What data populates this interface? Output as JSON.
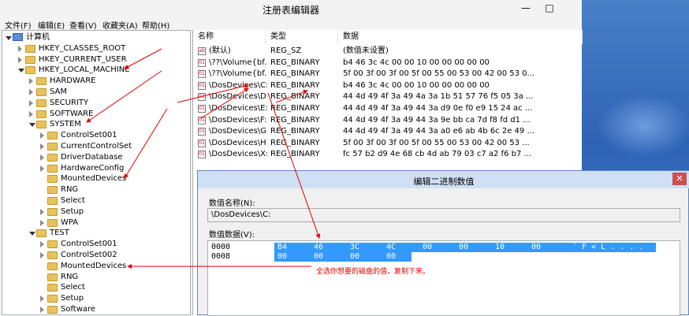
{
  "window": {
    "title": "注册表编辑器",
    "minimize": "—",
    "maximize": "□",
    "close": "✕"
  },
  "menu": [
    "文件(F)",
    "编辑(E)",
    "查看(V)",
    "收藏夹(A)",
    "帮助(H)"
  ],
  "tree": [
    {
      "label": "计算机",
      "level": 0,
      "state": "expanded",
      "icon": "computer-icon"
    },
    {
      "label": "HKEY_CLASSES_ROOT",
      "level": 1,
      "state": "collapsed",
      "icon": "folder-icon"
    },
    {
      "label": "HKEY_CURRENT_USER",
      "level": 1,
      "state": "collapsed",
      "icon": "folder-icon"
    },
    {
      "label": "HKEY_LOCAL_MACHINE",
      "level": 1,
      "state": "expanded",
      "icon": "folder-icon"
    },
    {
      "label": "HARDWARE",
      "level": 2,
      "state": "collapsed",
      "icon": "folder-icon"
    },
    {
      "label": "SAM",
      "level": 2,
      "state": "collapsed",
      "icon": "folder-icon"
    },
    {
      "label": "SECURITY",
      "level": 2,
      "state": "collapsed",
      "icon": "folder-icon"
    },
    {
      "label": "SOFTWARE",
      "level": 2,
      "state": "collapsed",
      "icon": "folder-icon"
    },
    {
      "label": "SYSTEM",
      "level": 2,
      "state": "expanded",
      "icon": "folder-icon"
    },
    {
      "label": "ControlSet001",
      "level": 3,
      "state": "collapsed",
      "icon": "folder-icon"
    },
    {
      "label": "CurrentControlSet",
      "level": 3,
      "state": "collapsed",
      "icon": "folder-icon"
    },
    {
      "label": "DriverDatabase",
      "level": 3,
      "state": "collapsed",
      "icon": "folder-icon"
    },
    {
      "label": "HardwareConfig",
      "level": 3,
      "state": "collapsed",
      "icon": "folder-icon"
    },
    {
      "label": "MountedDevices",
      "level": 3,
      "state": "none",
      "icon": "folder-icon"
    },
    {
      "label": "RNG",
      "level": 3,
      "state": "none",
      "icon": "folder-icon"
    },
    {
      "label": "Select",
      "level": 3,
      "state": "none",
      "icon": "folder-icon"
    },
    {
      "label": "Setup",
      "level": 3,
      "state": "collapsed",
      "icon": "folder-icon"
    },
    {
      "label": "WPA",
      "level": 3,
      "state": "collapsed",
      "icon": "folder-icon"
    },
    {
      "label": "TEST",
      "level": 2,
      "state": "expanded",
      "icon": "folder-icon"
    },
    {
      "label": "ControlSet001",
      "level": 3,
      "state": "collapsed",
      "icon": "folder-icon"
    },
    {
      "label": "ControlSet002",
      "level": 3,
      "state": "collapsed",
      "icon": "folder-icon"
    },
    {
      "label": "MountedDevices",
      "level": 3,
      "state": "none",
      "icon": "folder-icon"
    },
    {
      "label": "RNG",
      "level": 3,
      "state": "none",
      "icon": "folder-icon"
    },
    {
      "label": "Select",
      "level": 3,
      "state": "none",
      "icon": "folder-icon"
    },
    {
      "label": "Setup",
      "level": 3,
      "state": "collapsed",
      "icon": "folder-icon"
    },
    {
      "label": "Software",
      "level": 3,
      "state": "collapsed",
      "icon": "folder-icon"
    }
  ],
  "columns": {
    "name": "名称",
    "type": "类型",
    "data": "数据"
  },
  "values": [
    {
      "name": "(默认)",
      "type": "REG_SZ",
      "data": "(数值未设置)",
      "icon": "ab"
    },
    {
      "name": "\\??\\Volume{bf...",
      "type": "REG_BINARY",
      "data": "b4 46 3c 4c 00 00 10 00 00 00 00 00",
      "icon": "01"
    },
    {
      "name": "\\??\\Volume{bf...",
      "type": "REG_BINARY",
      "data": "5f 00 3f 00 3f 00 5f 00 55 00 53 00 42 00 53 0...",
      "icon": "01"
    },
    {
      "name": "\\DosDevices\\C:",
      "type": "REG_BINARY",
      "data": "b4 46 3c 4c 00 00 10 00 00 00 00 00",
      "icon": "01"
    },
    {
      "name": "\\DosDevices\\D:",
      "type": "REG_BINARY",
      "data": "44 4d 49 4f 3a 49 4a 3a 1b 51 57 76 f5 05 3a ...",
      "icon": "01"
    },
    {
      "name": "\\DosDevices\\E:",
      "type": "REG_BINARY",
      "data": "44 4d 49 4f 3a 49 44 3a d9 0e f0 e9 15 24 ac ...",
      "icon": "01"
    },
    {
      "name": "\\DosDevices\\F:",
      "type": "REG_BINARY",
      "data": "44 4d 49 4f 3a 49 44 3a 9e bb ca 7d f8 fd d1 ...",
      "icon": "01"
    },
    {
      "name": "\\DosDevices\\G:",
      "type": "REG_BINARY",
      "data": "44 4d 49 4f 3a 49 44 3a a0 e6 ab 4b 6c 2e 49 ...",
      "icon": "01"
    },
    {
      "name": "\\DosDevices\\H:",
      "type": "REG_BINARY",
      "data": "5f 00 3f 00 3f 00 5f 00 55 00 53 00 42 00 53 ...",
      "icon": "01"
    },
    {
      "name": "\\DosDevices\\X:",
      "type": "REG_BINARY",
      "data": "fc 57 b2 d9 4e 68 cb 4d ab 79 03 c7 a2 f6 b7 ...",
      "icon": "01"
    }
  ],
  "dialog": {
    "title": "编辑二进制数值",
    "close": "✕",
    "name_label": "数值名称(N):",
    "name_value": "\\DosDevices\\C:",
    "data_label": "数值数据(V):",
    "rows": [
      {
        "addr": "0000",
        "bytes": [
          "B4",
          "46",
          "3C",
          "4C",
          "00",
          "00",
          "10",
          "00"
        ],
        "ascii": "´ F < L . . . ."
      },
      {
        "addr": "0008",
        "bytes": [
          "00",
          "00",
          "00",
          "00"
        ],
        "ascii": ""
      }
    ],
    "note": "全选你想要的磁盘的值，复制下来。"
  },
  "colors": {
    "annotation": "#e00000",
    "selection": "#3399ff",
    "desktop": "#2f63b5"
  }
}
